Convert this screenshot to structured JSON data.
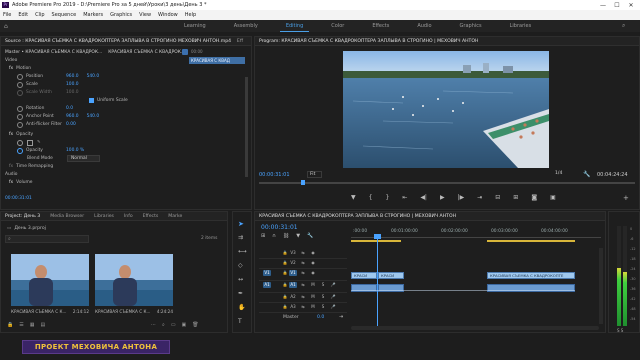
{
  "window": {
    "title": "Adobe Premiere Pro 2019 - D:\\Premiere Pro  за 5 дней\\Уроки\\3 день\\День 3 *",
    "min": "—",
    "max": "☐",
    "close": "✕"
  },
  "menu": [
    "File",
    "Edit",
    "Clip",
    "Sequence",
    "Markers",
    "Graphics",
    "View",
    "Window",
    "Help"
  ],
  "workspaces": [
    "Learning",
    "Assembly",
    "Editing",
    "Color",
    "Effects",
    "Audio",
    "Graphics",
    "Libraries"
  ],
  "active_workspace": "Editing",
  "effect_controls": {
    "tab_source": "Source : КРАСИВАЯ СЪЕМКА С КВАДРОКОПТЕРА ЗАПЛЫВА В СТРОГИНО МЕХОВИЧ АНТОН.mp4",
    "tab_lumetri": "Eff",
    "clip_path": "Master • КРАСИВАЯ СЪЕМКА С КВАДРОК...",
    "clip_right": "КРАСИВАЯ СЪЕМКА С КВАДРОК...",
    "time_top": "00:00",
    "clip_mini": "КРАСИВАЯ С КВАД",
    "video_label": "Video",
    "motion": "Motion",
    "position_label": "Position",
    "position_x": "960.0",
    "position_y": "540.0",
    "scale_label": "Scale",
    "scale_val": "100.0",
    "scale_width_label": "Scale Width",
    "scale_width_val": "100.0",
    "uniform_scale": "Uniform Scale",
    "rotation_label": "Rotation",
    "rotation_val": "0.0",
    "anchor_label": "Anchor Point",
    "anchor_x": "960.0",
    "anchor_y": "540.0",
    "antiflicker_label": "Anti-flicker Filter",
    "antiflicker_val": "0.00",
    "opacity": "Opacity",
    "opacity_label": "Opacity",
    "opacity_val": "100.0 %",
    "blend_label": "Blend Mode",
    "blend_val": "Normal",
    "time_remap": "Time Remapping",
    "audio_label": "Audio",
    "volume": "Volume",
    "timecode": "00:00:31:01"
  },
  "program": {
    "title": "Program: КРАСИВАЯ СЪЕМКА С КВАДРОКОПТЕРА ЗАПЛЫВА В СТРОГИНО | МЕХОВИЧ АНТОН",
    "timecode": "00:00:31:01",
    "fit": "Fit",
    "quality": "1/4",
    "duration": "00:04:24:24"
  },
  "project": {
    "tabs": [
      "Project: День 3",
      "Media Browser",
      "Libraries",
      "Info",
      "Effects",
      "Marke"
    ],
    "file": "День 3.prproj",
    "search_placeholder": "",
    "items_count": "2 items",
    "clips": [
      {
        "name": "КРАСИВАЯ СЪЕМКА С К...",
        "duration": "2:14:12"
      },
      {
        "name": "КРАСИВАЯ СЪЕМКА С К...",
        "duration": "4:24:24"
      }
    ]
  },
  "timeline": {
    "tab": "КРАСИВАЯ СЪЕМКА С КВАДРОКОПТЕРА ЗАПЛЫВА В СТРОГИНО | МЕХОВИЧ АНТОН",
    "timecode": "00:00:31:01",
    "ruler": [
      ":00:00",
      "00:01:00:00",
      "00:02:00:00",
      "00:03:00:00",
      "00:04:00:00"
    ],
    "tracks": [
      "V3",
      "V2",
      "V1",
      "A1",
      "A2",
      "A3"
    ],
    "master": "Master",
    "master_val": "0.0",
    "clip_v1_a": "КРАСИ",
    "clip_v1_b": "КРАСИ",
    "clip_v1_c": "КРАСИВАЯ СЪЕМКА С КВАДРОКОПТЕ"
  },
  "meter_ticks": [
    "0",
    "-6",
    "-12",
    "-18",
    "-24",
    "-30",
    "-36",
    "-42",
    "-48",
    "-54"
  ],
  "watermark": "ПРОЕКТ МЕХОВИЧА АНТОНА",
  "colors": {
    "accent": "#4a9fe6",
    "watermark_bg": "#3a2466",
    "watermark_text": "#f0c23a"
  }
}
